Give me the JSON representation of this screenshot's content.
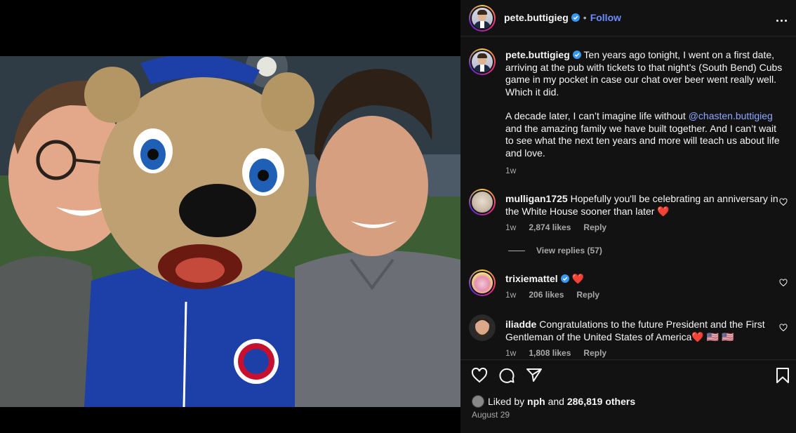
{
  "post": {
    "author": "pete.buttigieg",
    "follow_label": "Follow",
    "separator": "•",
    "caption_paragraph_1": "Ten years ago tonight, I went on a first date, arriving at the pub with tickets to that night’s (South Bend) Cubs game in my pocket in case our chat over beer went really well. Which it did.",
    "caption_paragraph_2_before": "A decade later, I can’t imagine life without ",
    "caption_mention": "@chasten.buttigieg",
    "caption_paragraph_2_after": " and the amazing family we have built together. And I can’t wait to see what the next ten years and more will teach us about life and love.",
    "caption_time": "1w",
    "liked_by_prefix": "Liked by ",
    "liked_by_user": "nph",
    "liked_by_middle": " and ",
    "liked_by_count": "286,819 others",
    "date": "August 29"
  },
  "comments": [
    {
      "user": "mulligan1725",
      "text": "Hopefully you'll be celebrating an anniversary in the White House sooner than later ❤️",
      "time": "1w",
      "likes": "2,874 likes",
      "reply_label": "Reply",
      "view_replies": "View replies (57)"
    },
    {
      "user": "trixiemattel",
      "text": "❤️",
      "time": "1w",
      "likes": "206 likes",
      "reply_label": "Reply"
    },
    {
      "user": "iliadde",
      "text": "Congratulations to the future President and the First Gentleman of the United States of America❤️ 🇺🇸 🇺🇸",
      "time": "1w",
      "likes": "1,808 likes",
      "reply_label": "Reply"
    }
  ],
  "icons": {
    "verified": "verified-badge-icon",
    "more": "more-options-icon",
    "like": "heart-icon",
    "comment": "comment-icon",
    "share": "send-icon",
    "save": "bookmark-icon"
  },
  "colors": {
    "panel_bg": "#121212",
    "link": "#6b8cff",
    "mention": "#8fa9ff",
    "verified": "#3897f0",
    "heart": "#ff3040"
  }
}
